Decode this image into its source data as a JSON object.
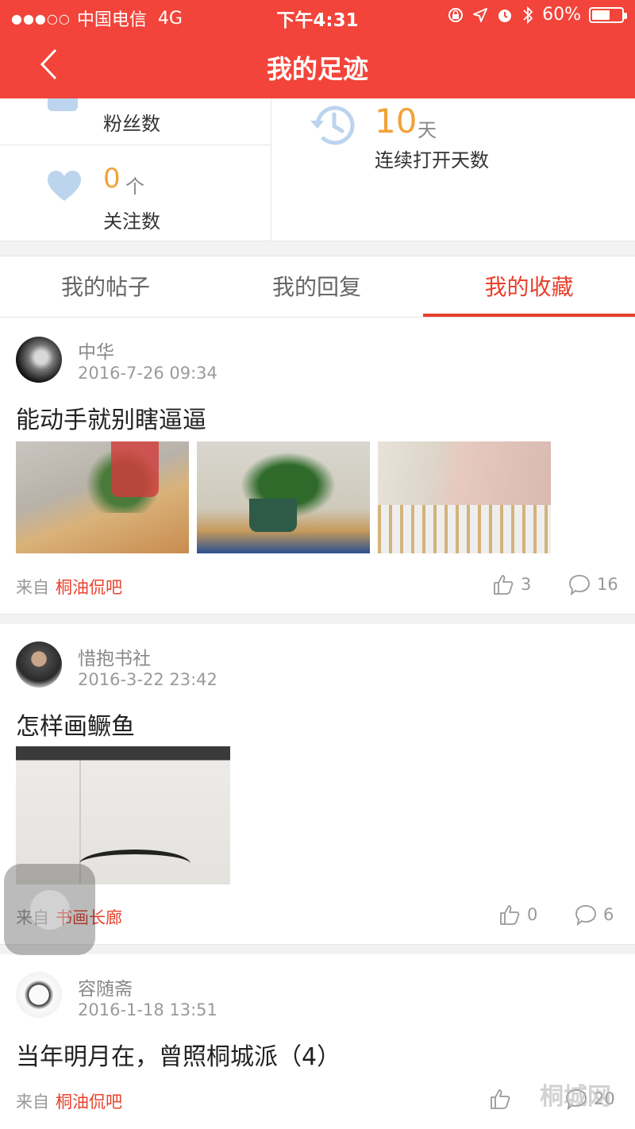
{
  "status_bar": {
    "signal": "●●●○○",
    "carrier": "中国电信",
    "network": "4G",
    "time": "下午4:31",
    "battery": "60%",
    "battery_level": 0.6
  },
  "nav": {
    "title": "我的足迹"
  },
  "stats": {
    "fans_label": "粉丝数",
    "follow_value": "0",
    "follow_unit": "个",
    "follow_label": "关注数",
    "days_value": "10",
    "days_unit": "天",
    "days_label": "连续打开天数"
  },
  "tabs": [
    {
      "label": "我的帖子"
    },
    {
      "label": "我的回复"
    },
    {
      "label": "我的收藏"
    }
  ],
  "posts": [
    {
      "author": "中华",
      "date": "2016-7-26 09:34",
      "title": "能动手就别瞎逼逼",
      "from_label": "来自",
      "board": "桐油侃吧",
      "likes": "3",
      "comments": "16"
    },
    {
      "author": "惜抱书社",
      "date": "2016-3-22 23:42",
      "title": "怎样画鳜鱼",
      "from_label": "来自",
      "board": "书画长廊",
      "likes": "0",
      "comments": "6"
    },
    {
      "author": "容随斋",
      "date": "2016-1-18 13:51",
      "title": "当年明月在，曾照桐城派（4）",
      "from_label": "来自",
      "board": "桐油侃吧",
      "likes": "",
      "comments": "20"
    }
  ],
  "watermark": "桐城网",
  "colors": {
    "brand": "#f2443a",
    "accent": "#e8412e",
    "value": "#f2a238",
    "icon": "#bcd4ee"
  }
}
